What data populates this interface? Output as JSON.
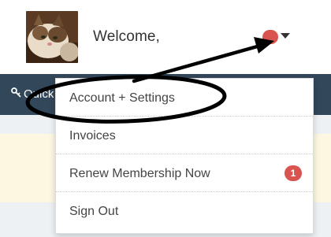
{
  "header": {
    "welcome_text": "Welcome,",
    "notification_color": "#d9534f"
  },
  "navbar": {
    "first_item_label": "Quick Links",
    "icon": "link-icon"
  },
  "dropdown": {
    "items": [
      {
        "label": "Account + Settings"
      },
      {
        "label": "Invoices"
      },
      {
        "label": "Renew Membership Now",
        "badge": "1"
      },
      {
        "label": "Sign Out"
      }
    ]
  },
  "annotation": {
    "shapes": [
      "ellipse-highlight",
      "arrow"
    ],
    "color": "#000000"
  }
}
